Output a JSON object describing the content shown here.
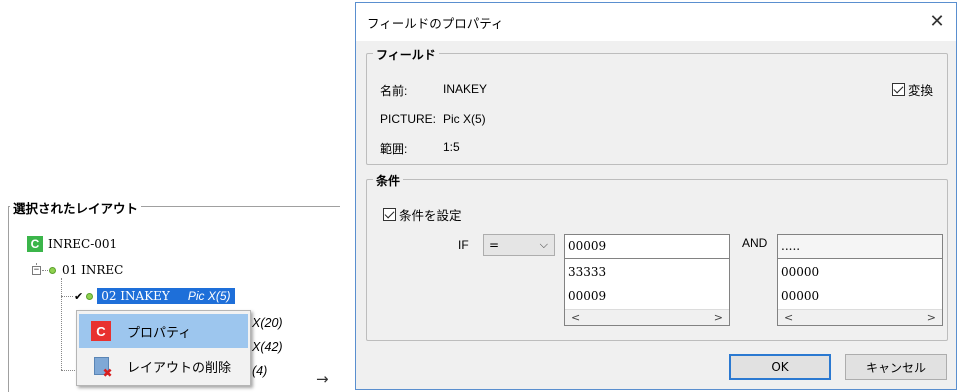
{
  "left_panel": {
    "section_title": "選択されたレイアウト",
    "tree": {
      "root_icon": "C",
      "root_label": "INREC-001",
      "level1_label": "01 INREC",
      "selected_label": "02 INAKEY",
      "selected_pic": "Pic X(5)",
      "hidden_row_tails": [
        "X(20)",
        "X(42)",
        "(4)"
      ]
    },
    "context_menu": {
      "items": [
        {
          "label": "プロパティ",
          "icon": "properties-c-icon"
        },
        {
          "label": "レイアウトの削除",
          "icon": "delete-layout-icon"
        }
      ]
    },
    "arrow": "→"
  },
  "dialog": {
    "title": "フィールドのプロパティ",
    "close_glyph": "✕",
    "field_group": {
      "title": "フィールド",
      "name_label": "名前:",
      "name_value": "INAKEY",
      "picture_label": "PICTURE:",
      "picture_value": "Pic X(5)",
      "range_label": "範囲:",
      "range_value": "1:5",
      "convert_label": "変換",
      "convert_checked": true
    },
    "condition_group": {
      "title": "条件",
      "set_condition_label": "条件を設定",
      "set_condition_checked": true,
      "if_label": "IF",
      "operator": "=",
      "and_label": "AND",
      "list1": {
        "input": "00009",
        "items": [
          "33333",
          "00009"
        ]
      },
      "list2": {
        "input": ".....",
        "items": [
          "00000",
          "00000"
        ]
      }
    },
    "ok_label": "OK",
    "cancel_label": "キャンセル"
  }
}
